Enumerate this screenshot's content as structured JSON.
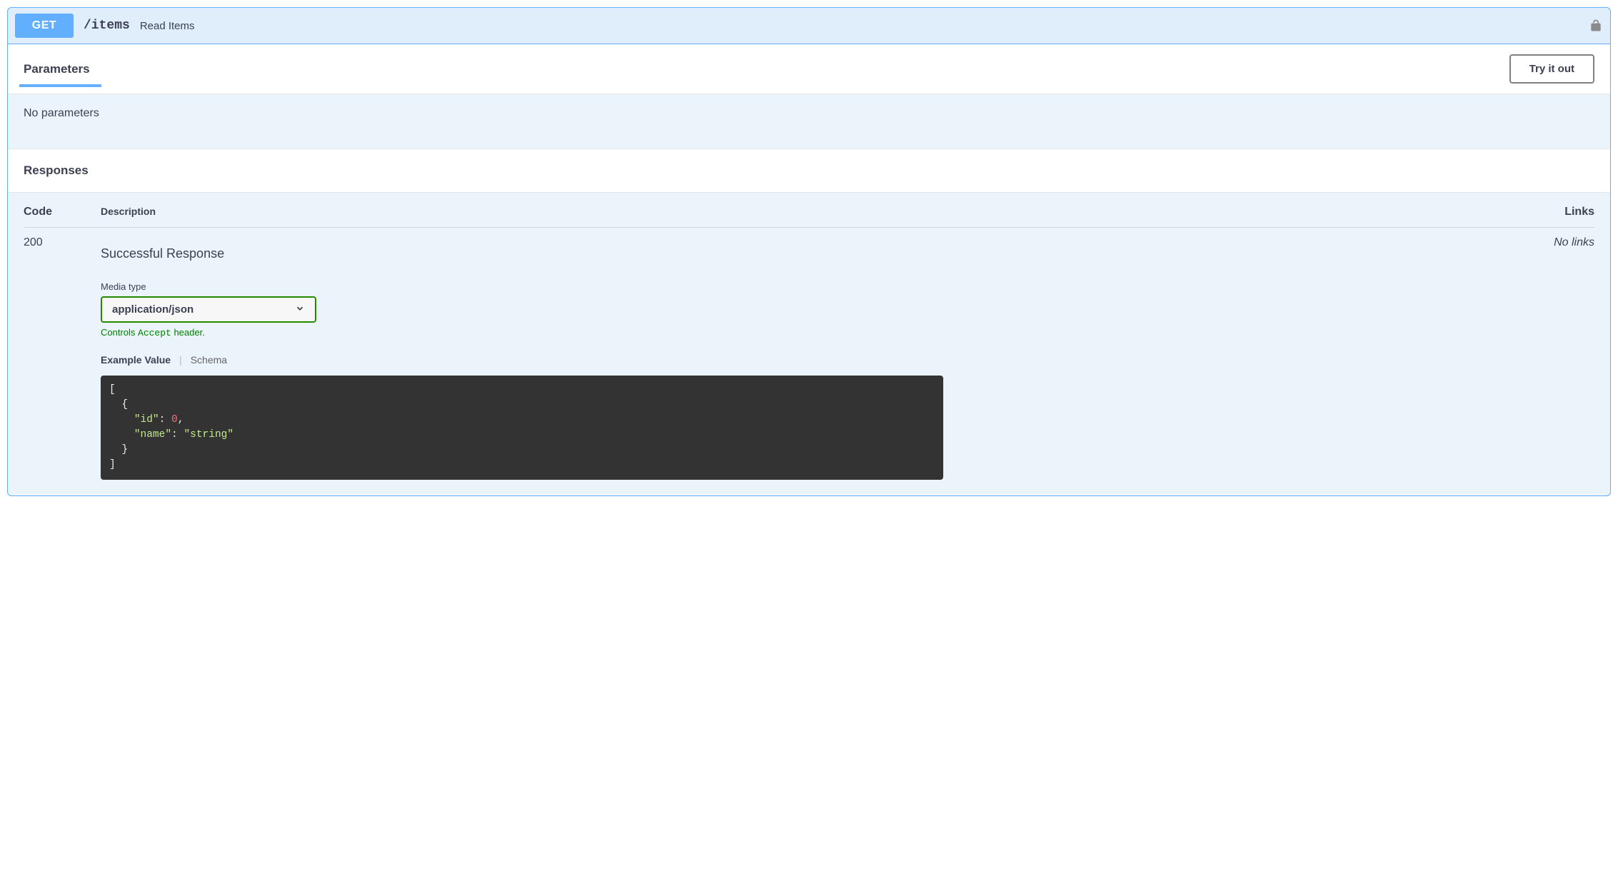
{
  "operation": {
    "method": "GET",
    "path": "/items",
    "summary": "Read Items"
  },
  "sections": {
    "parameters_label": "Parameters",
    "responses_label": "Responses",
    "try_it_out": "Try it out",
    "no_parameters": "No parameters"
  },
  "response_table": {
    "headers": {
      "code": "Code",
      "description": "Description",
      "links": "Links"
    },
    "rows": [
      {
        "code": "200",
        "description": "Successful Response",
        "links": "No links",
        "media_type": {
          "label": "Media type",
          "selected": "application/json",
          "note_prefix": "Controls ",
          "note_code": "Accept",
          "note_suffix": " header."
        },
        "tabs": {
          "active": "Example Value",
          "inactive": "Schema"
        },
        "example": {
          "lines": [
            {
              "indent": 0,
              "tokens": [
                {
                  "t": "punc",
                  "v": "["
                }
              ]
            },
            {
              "indent": 1,
              "tokens": [
                {
                  "t": "punc",
                  "v": "{"
                }
              ]
            },
            {
              "indent": 2,
              "tokens": [
                {
                  "t": "key",
                  "v": "\"id\""
                },
                {
                  "t": "punc",
                  "v": ": "
                },
                {
                  "t": "num",
                  "v": "0"
                },
                {
                  "t": "punc",
                  "v": ","
                }
              ]
            },
            {
              "indent": 2,
              "tokens": [
                {
                  "t": "key",
                  "v": "\"name\""
                },
                {
                  "t": "punc",
                  "v": ": "
                },
                {
                  "t": "str",
                  "v": "\"string\""
                }
              ]
            },
            {
              "indent": 1,
              "tokens": [
                {
                  "t": "punc",
                  "v": "}"
                }
              ]
            },
            {
              "indent": 0,
              "tokens": [
                {
                  "t": "punc",
                  "v": "]"
                }
              ]
            }
          ]
        }
      }
    ]
  }
}
